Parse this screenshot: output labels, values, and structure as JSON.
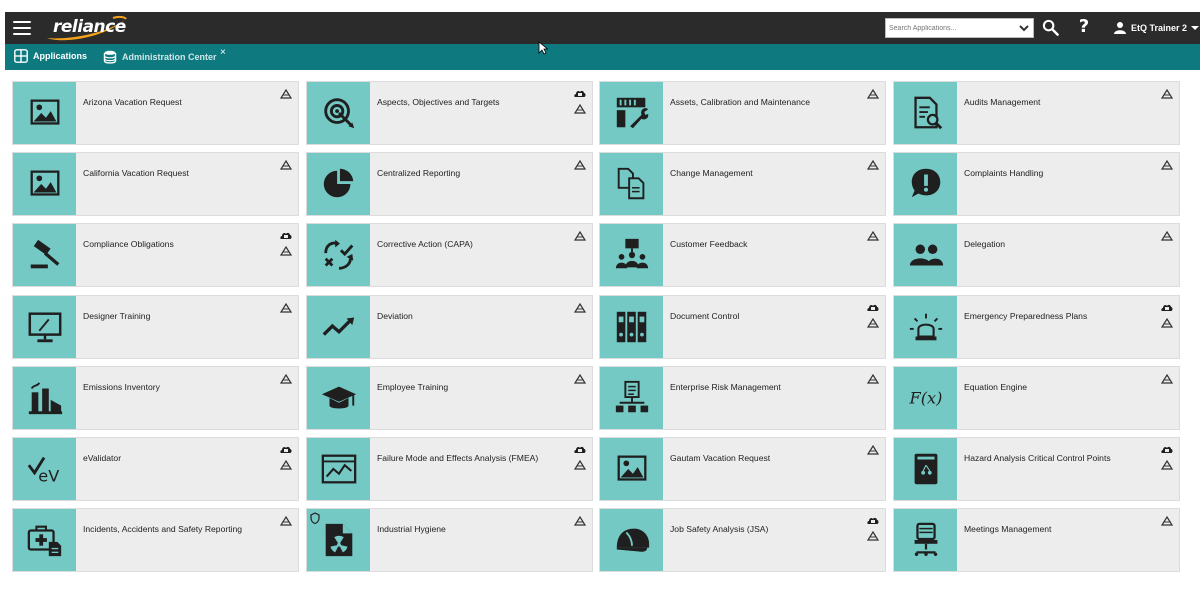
{
  "topbar": {
    "logo_text": "reliance",
    "search_placeholder": "Search Applications...",
    "user_name": "EtQ Trainer 2",
    "help_symbol": "?"
  },
  "tabs": [
    {
      "label": "Applications",
      "icon": "grid-icon",
      "active": true
    },
    {
      "label": "Administration Center",
      "icon": "database-icon",
      "active": false,
      "close": "×"
    }
  ],
  "tiles": [
    {
      "label": "Arizona Vacation Request",
      "icon": "picture-icon",
      "cloud": false
    },
    {
      "label": "Aspects, Objectives and Targets",
      "icon": "target-icon",
      "cloud": true
    },
    {
      "label": "Assets, Calibration and Maintenance",
      "icon": "tools-icon",
      "cloud": false
    },
    {
      "label": "Audits Management",
      "icon": "audit-document-icon",
      "cloud": false
    },
    {
      "label": "California Vacation Request",
      "icon": "picture-icon",
      "cloud": false
    },
    {
      "label": "Centralized Reporting",
      "icon": "pie-chart-icon",
      "cloud": false
    },
    {
      "label": "Change Management",
      "icon": "document-change-icon",
      "cloud": false
    },
    {
      "label": "Complaints Handling",
      "icon": "exclamation-icon",
      "cloud": false
    },
    {
      "label": "Compliance Obligations",
      "icon": "gavel-icon",
      "cloud": true
    },
    {
      "label": "Corrective Action (CAPA)",
      "icon": "corrective-action-icon",
      "cloud": false
    },
    {
      "label": "Customer Feedback",
      "icon": "audience-icon",
      "cloud": false
    },
    {
      "label": "Delegation",
      "icon": "people-icon",
      "cloud": false
    },
    {
      "label": "Designer Training",
      "icon": "monitor-icon",
      "cloud": false
    },
    {
      "label": "Deviation",
      "icon": "trend-line-icon",
      "cloud": false
    },
    {
      "label": "Document Control",
      "icon": "binders-icon",
      "cloud": true
    },
    {
      "label": "Emergency Preparedness Plans",
      "icon": "alarm-light-icon",
      "cloud": true
    },
    {
      "label": "Emissions Inventory",
      "icon": "factory-icon",
      "cloud": false
    },
    {
      "label": "Employee Training",
      "icon": "graduation-cap-icon",
      "cloud": false
    },
    {
      "label": "Enterprise Risk Management",
      "icon": "org-chart-icon",
      "cloud": false
    },
    {
      "label": "Equation Engine",
      "icon": "function-icon",
      "cloud": false
    },
    {
      "label": "eValidator",
      "icon": "check-ev-icon",
      "cloud": true
    },
    {
      "label": "Failure Mode and Effects Analysis (FMEA)",
      "icon": "chart-window-icon",
      "cloud": true
    },
    {
      "label": "Gautam Vacation Request",
      "icon": "picture-icon",
      "cloud": false
    },
    {
      "label": "Hazard Analysis Critical Control Points",
      "icon": "hazard-jar-icon",
      "cloud": true
    },
    {
      "label": "Incidents, Accidents and Safety Reporting",
      "icon": "first-aid-kit-icon",
      "cloud": false
    },
    {
      "label": "Industrial Hygiene",
      "icon": "radiation-file-icon",
      "cloud": false,
      "shield": true
    },
    {
      "label": "Job Safety Analysis (JSA)",
      "icon": "hard-hat-icon",
      "cloud": true
    },
    {
      "label": "Meetings Management",
      "icon": "office-chair-icon",
      "cloud": false
    }
  ],
  "colors": {
    "topbar": "#2b2b2b",
    "tabbar": "#0e7a80",
    "tile_bg": "#ededed",
    "icon_bg": "#74c9c4",
    "icon_fg": "#1f1f1f"
  }
}
